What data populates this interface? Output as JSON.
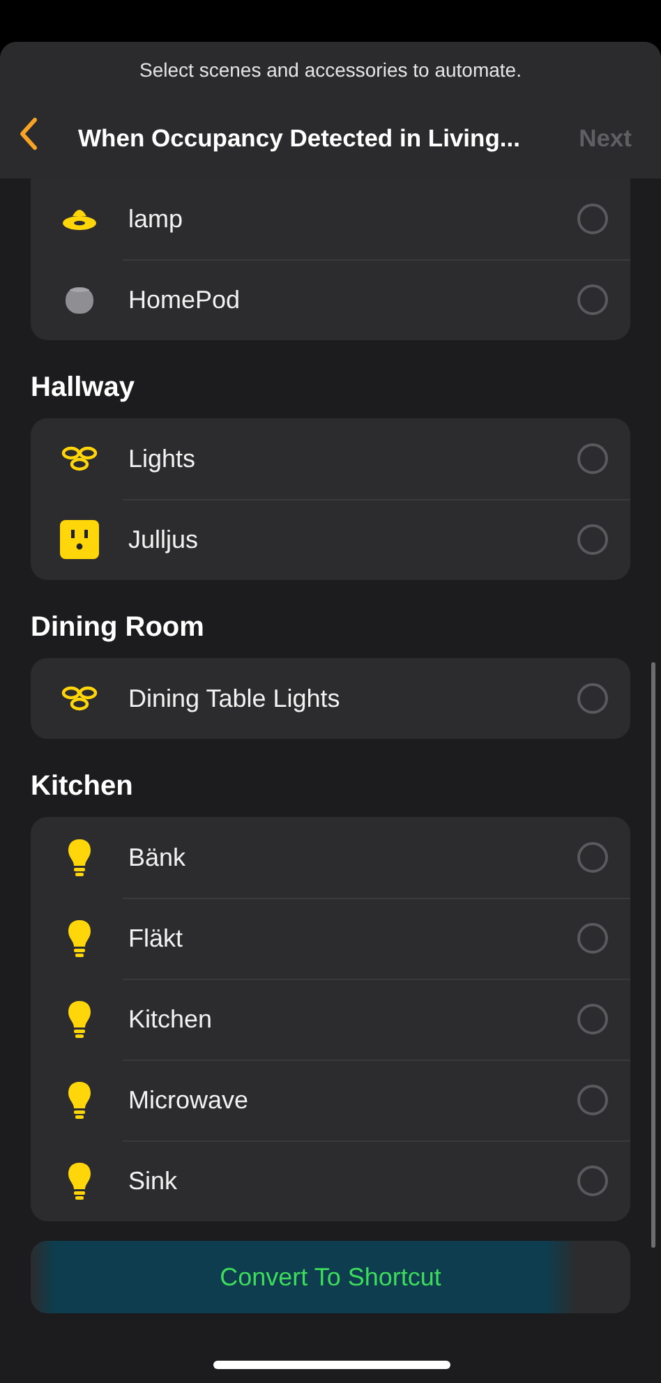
{
  "header": {
    "subtitle": "Select scenes and accessories to automate.",
    "title": "When Occupancy Detected in Living...",
    "next": "Next",
    "next_disabled": true
  },
  "sections": [
    {
      "items": [
        {
          "kind": "lamp",
          "name": "lamp",
          "selected": false
        },
        {
          "kind": "speaker",
          "name": "HomePod",
          "selected": false
        }
      ]
    },
    {
      "title": "Hallway",
      "items": [
        {
          "kind": "ceiling-lights",
          "name": "Lights",
          "selected": false
        },
        {
          "kind": "outlet",
          "name": "Julljus",
          "selected": false
        }
      ]
    },
    {
      "title": "Dining Room",
      "items": [
        {
          "kind": "ceiling-lights",
          "name": "Dining Table Lights",
          "selected": false
        }
      ]
    },
    {
      "title": "Kitchen",
      "items": [
        {
          "kind": "bulb",
          "name": "Bänk",
          "selected": false
        },
        {
          "kind": "bulb",
          "name": "Fläkt",
          "selected": false
        },
        {
          "kind": "bulb",
          "name": "Kitchen",
          "selected": false
        },
        {
          "kind": "bulb",
          "name": "Microwave",
          "selected": false
        },
        {
          "kind": "bulb",
          "name": "Sink",
          "selected": false
        }
      ]
    }
  ],
  "action": {
    "label": "Convert To Shortcut",
    "highlighted": true
  }
}
